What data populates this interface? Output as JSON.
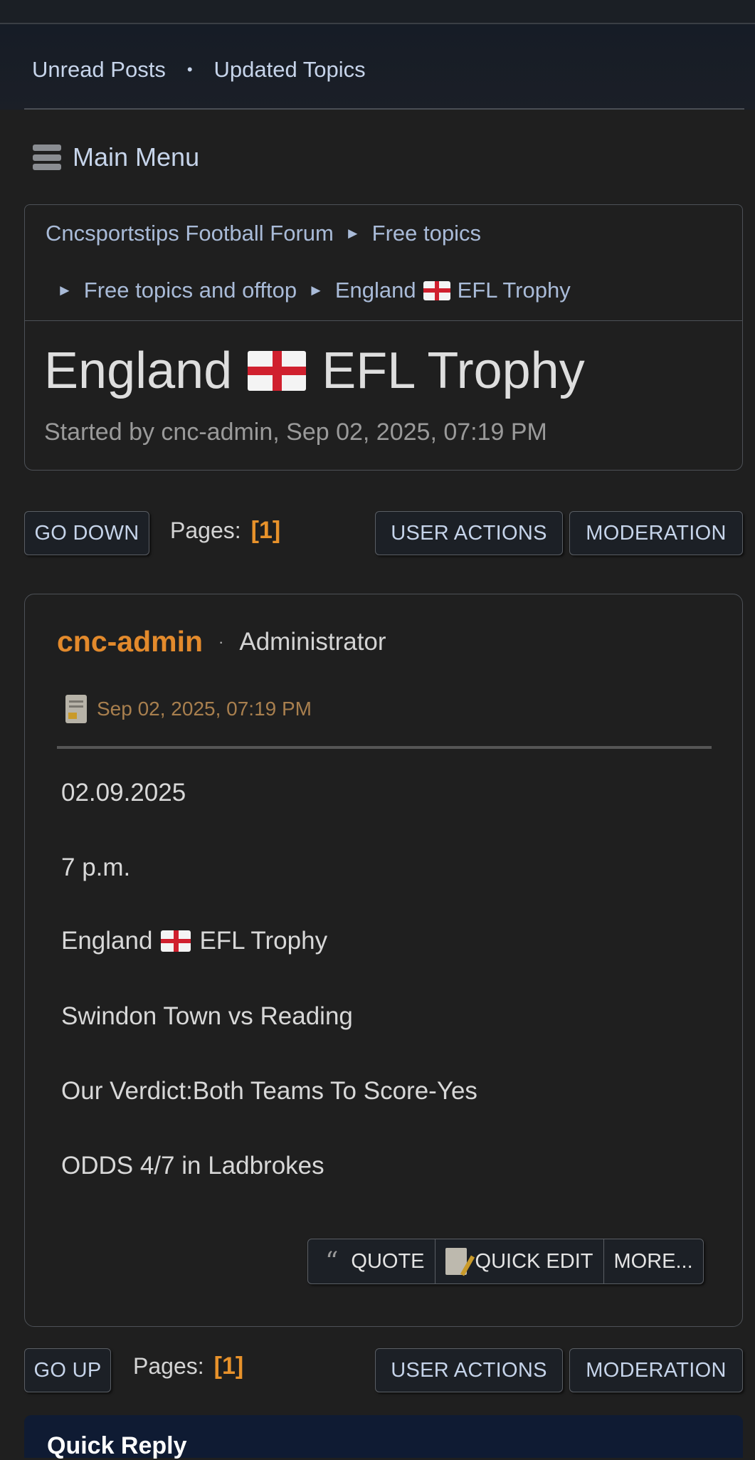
{
  "nav": {
    "unread": "Unread Posts",
    "updated": "Updated Topics"
  },
  "menu": {
    "label": "Main Menu",
    "icon": "hamburger-icon"
  },
  "breadcrumb": {
    "forum": "Cncsportstips Football Forum",
    "board": "Free topics",
    "subboard": "Free topics and offtop",
    "topic_a": "England",
    "topic_b": "EFL Trophy"
  },
  "topic": {
    "title_a": "England",
    "title_b": "EFL Trophy",
    "started": "Started by cnc-admin, Sep 02, 2025, 07:19 PM"
  },
  "controls_top": {
    "go": "GO DOWN",
    "pages_label": "Pages:",
    "page": "[1]",
    "user_actions": "USER ACTIONS",
    "moderation": "MODERATION"
  },
  "post": {
    "author": "cnc-admin",
    "role": "Administrator",
    "date": "Sep 02, 2025, 07:19 PM",
    "lines": {
      "date": "02.09.2025",
      "time": "7 p.m.",
      "league_a": "England",
      "league_b": "EFL Trophy",
      "match": "Swindon Town vs Reading",
      "verdict": "Our Verdict:Both Teams To Score-Yes",
      "odds": "ODDS 4/7 in Ladbrokes"
    },
    "actions": {
      "quote": "QUOTE",
      "quick_edit": "QUICK EDIT",
      "more": "MORE..."
    }
  },
  "controls_bottom": {
    "go": "GO UP",
    "pages_label": "Pages:",
    "page": "[1]",
    "user_actions": "USER ACTIONS",
    "moderation": "MODERATION"
  },
  "quick_reply": {
    "title": "Quick Reply"
  },
  "colors": {
    "accent_orange": "#e38a2c",
    "link": "#a9bbd8",
    "background": "#1f1f1f"
  }
}
